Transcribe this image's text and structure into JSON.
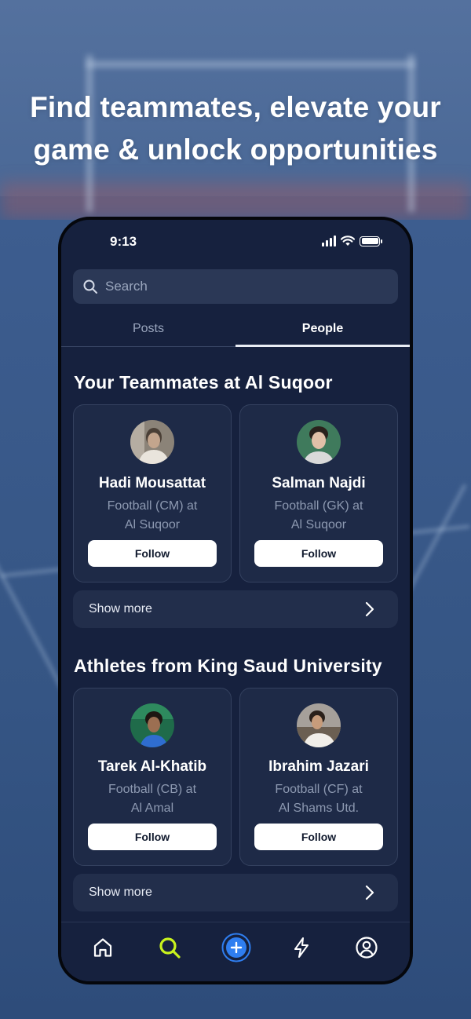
{
  "headline": {
    "line1": "Find teammates, elevate your",
    "line2": "game & unlock opportunities"
  },
  "status_bar": {
    "time": "9:13"
  },
  "search": {
    "placeholder": "Search"
  },
  "tabs": [
    {
      "label": "Posts",
      "active": false
    },
    {
      "label": "People",
      "active": true
    }
  ],
  "sections": [
    {
      "title": "Your Teammates at Al Suqoor",
      "cards": [
        {
          "name": "Hadi Mousattat",
          "position": "Football (CM) at",
          "club": "Al Suqoor",
          "follow_label": "Follow"
        },
        {
          "name": "Salman Najdi",
          "position": "Football (GK) at",
          "club": "Al Suqoor",
          "follow_label": "Follow"
        }
      ],
      "show_more_label": "Show more"
    },
    {
      "title": "Athletes from King Saud University",
      "cards": [
        {
          "name": "Tarek Al-Khatib",
          "position": "Football (CB) at",
          "club": "Al Amal",
          "follow_label": "Follow"
        },
        {
          "name": "Ibrahim Jazari",
          "position": "Football (CF) at",
          "club": "Al Shams Utd.",
          "follow_label": "Follow"
        }
      ],
      "show_more_label": "Show more"
    }
  ],
  "bottom_nav": [
    {
      "icon": "home-icon",
      "active": false
    },
    {
      "icon": "search-icon",
      "active": true
    },
    {
      "icon": "add-icon",
      "active": false
    },
    {
      "icon": "lightning-icon",
      "active": false
    },
    {
      "icon": "profile-icon",
      "active": false
    }
  ],
  "colors": {
    "accent_lime": "#c9f31d",
    "accent_blue": "#2f7ef0",
    "screen_bg": "#16213e",
    "card_bg": "#1e2a47"
  }
}
